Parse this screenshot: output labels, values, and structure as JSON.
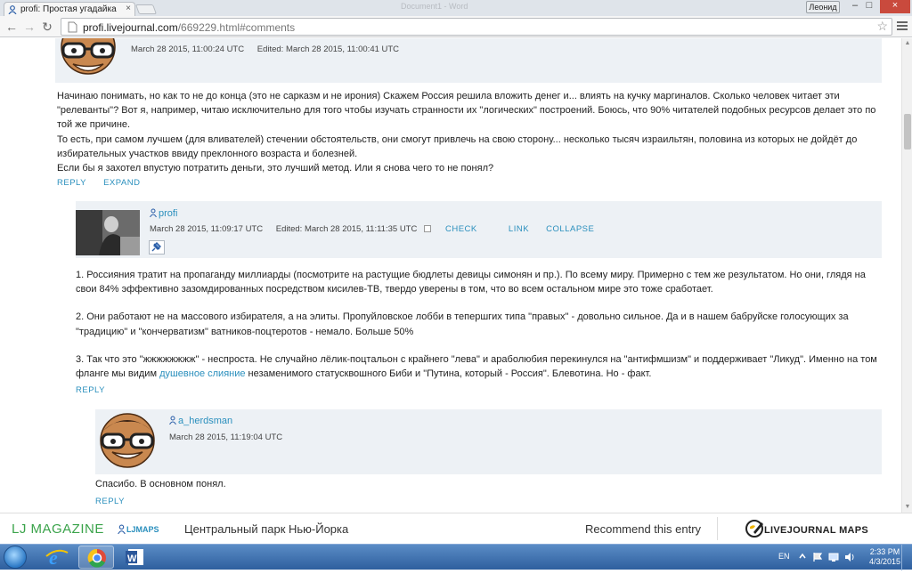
{
  "browser": {
    "tab_title": "profi: Простая угадайка",
    "tab_close": "×",
    "faint_title": "Document1 - Word",
    "window_user": "Леонид",
    "win_minimize": "–",
    "win_maximize": "□",
    "win_close": "×",
    "nav_back": "←",
    "nav_forward": "→",
    "nav_reload": "↻",
    "url_host": "profi.livejournal.com",
    "url_path": "/669229.html#comments",
    "star": "☆"
  },
  "comments": [
    {
      "meta_posted": "March 28 2015, 11:00:24 UTC",
      "meta_edited_label": "Edited:",
      "meta_edited": "March 28 2015, 11:00:41 UTC",
      "body": [
        "Начинаю понимать, но как то не до конца (это не сарказм и не ирония) Скажем Россия решила вложить денег и... влиять на кучку маргиналов. Сколько человек читает эти \"релеванты\"? Вот я, например, читаю исключительно для того чтобы изучать странности их \"логических\" построений. Боюсь, что 90% читателей подобных ресурсов делает это по той же причине.",
        "То есть, при самом лучшем (для вливателей) стечении обстоятельств, они смогут привлечь на свою сторону... несколько тысяч израильтян, половина из которых не дойдёт до избирательных участков ввиду преклонного возраста и болезней.",
        "Если бы я захотел впустую потратить деньги, это лучший метод. Или я снова чего то не понял?"
      ],
      "reply": "REPLY",
      "expand": "EXPAND"
    },
    {
      "username": "profi",
      "meta_posted": "March 28 2015, 11:09:17 UTC",
      "meta_edited_label": "Edited:",
      "meta_edited": "March 28 2015, 11:11:35 UTC",
      "check": "CHECK",
      "link": "LINK",
      "collapse": "COLLAPSE",
      "p1": "1. Россияния тратит на пропаганду миллиарды (посмотрите на растущие бюдлеты девицы симонян и пр.). По всему миру. Примерно с тем же результатом. Но они, глядя на свои 84% эффективно зазомдированных посредством кисилев-ТВ, твердо уверены в том, что во всем остальном мире это тоже сработает.",
      "p2": "2. Они работают не на массового избирателя, а на элиты. Пропуйловское лобби в тепершгих типа \"правых\" - довольно сильное. Да и в нашем бабруйске голосующих за \"традицию\" и \"кончерватизм\" ватников-поцтеротов - немало. Больше 50%",
      "p3a": "3. Так что это \"жжжжжжжж\" - неспроста. Не случайно лёлик-поцтальон с крайнего \"лева\" и араболюбия перекинулся на \"антифмшизм\" и поддерживает \"Ликуд\". Именно на том фланге мы видим ",
      "p3link": "душевное слияние",
      "p3b": " незаменимого статусквошного Биби и \"Путина, который - Россия\". Блевотина. Но - факт.",
      "reply": "REPLY"
    },
    {
      "username": "a_herdsman",
      "meta_posted": "March 28 2015, 11:19:04 UTC",
      "body": "Спасибо. В основном понял.",
      "reply": "REPLY"
    }
  ],
  "bottom_bar": {
    "magazine": "LJ MAGAZINE",
    "ljmaps_tag": "LJMAPS",
    "place": "Центральный парк Нью-Йорка",
    "recommend": "Recommend this entry",
    "ljmaps_logo": "LIVEJOURNAL MAPS"
  },
  "taskbar": {
    "lang": "EN",
    "time": "2:33 PM",
    "date": "4/3/2015"
  }
}
